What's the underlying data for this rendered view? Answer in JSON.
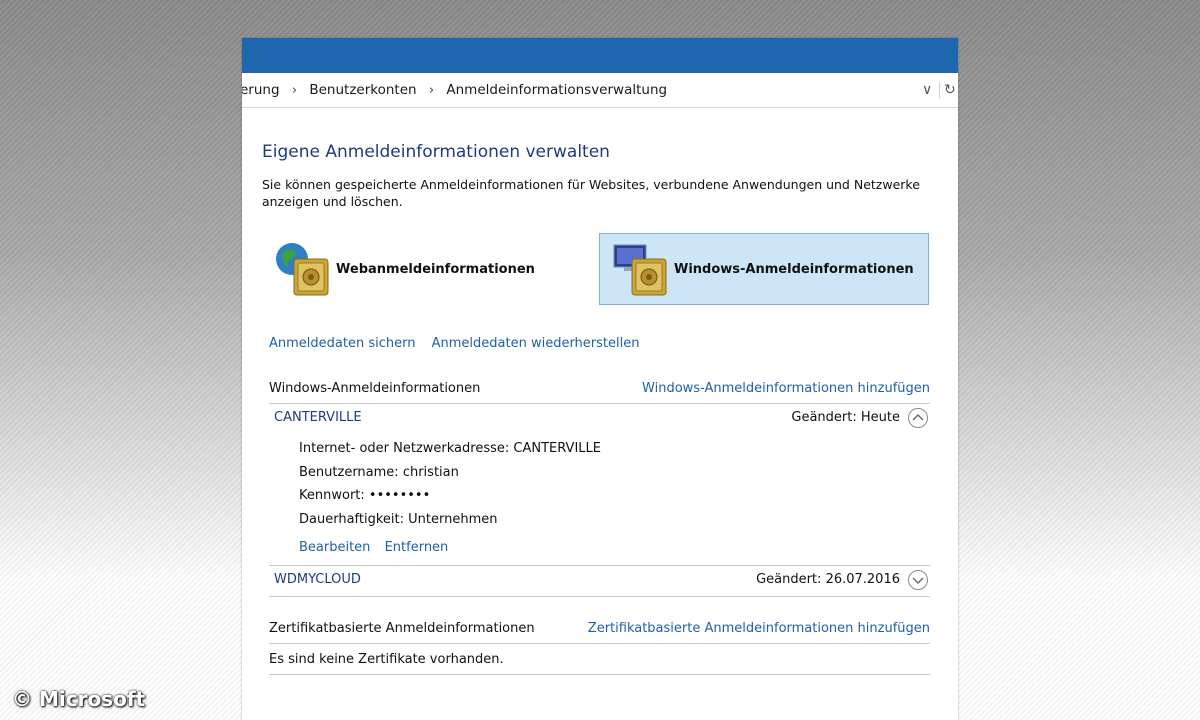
{
  "addressbar": {
    "crumbs": [
      "erung",
      "Benutzerkonten",
      "Anmeldeinformationsverwaltung"
    ],
    "dropdown_glyph": "∨",
    "refresh_glyph": "↻"
  },
  "page": {
    "title": "Eigene Anmeldeinformationen verwalten",
    "description": "Sie können gespeicherte Anmeldeinformationen für Websites, verbundene Anwendungen und Netzwerke anzeigen und löschen."
  },
  "tiles": {
    "web": "Webanmeldeinformationen",
    "windows": "Windows-Anmeldeinformationen"
  },
  "links": {
    "backup": "Anmeldedaten sichern",
    "restore": "Anmeldedaten wiederherstellen"
  },
  "windows_section": {
    "header": "Windows-Anmeldeinformationen",
    "add_link": "Windows-Anmeldeinformationen hinzufügen",
    "entries": [
      {
        "name": "CANTERVILLE",
        "changed_label": "Geändert:",
        "changed_value": "Heute",
        "expanded": true,
        "details": [
          {
            "label": "Internet- oder Netzwerkadresse:",
            "value": "CANTERVILLE"
          },
          {
            "label": "Benutzername:",
            "value": "christian"
          },
          {
            "label": "Kennwort:",
            "value": "••••••••"
          },
          {
            "label": "Dauerhaftigkeit:",
            "value": "Unternehmen"
          }
        ],
        "edit_label": "Bearbeiten",
        "remove_label": "Entfernen"
      },
      {
        "name": "WDMYCLOUD",
        "changed_label": "Geändert:",
        "changed_value": "26.07.2016",
        "expanded": false
      }
    ]
  },
  "cert_section": {
    "header": "Zertifikatbasierte Anmeldeinformationen",
    "add_link": "Zertifikatbasierte Anmeldeinformationen hinzufügen",
    "empty_text": "Es sind keine Zertifikate vorhanden."
  },
  "watermark": "© Microsoft",
  "colors": {
    "titlebar": "#1e66ad",
    "link": "#1f5fa8",
    "title": "#1d3b83",
    "selected_tile": "#cde6f7"
  }
}
